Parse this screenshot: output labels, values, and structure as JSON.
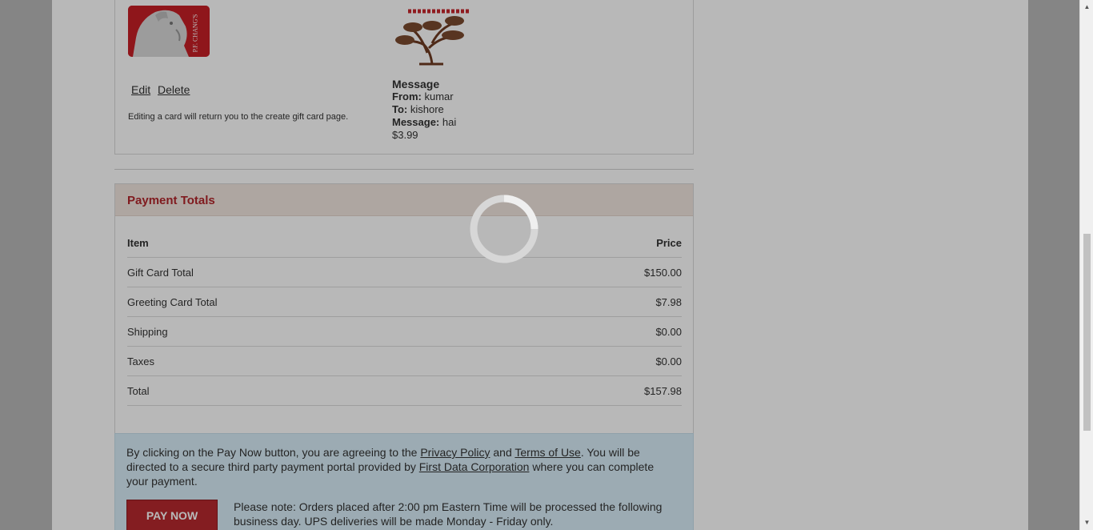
{
  "cart_item": {
    "card_image_alt": "P.F. Chang's gift card",
    "card_brand_text": "P.F. CHANG'S",
    "edit_label": "Edit",
    "delete_label": "Delete",
    "edit_note": "Editing a card will return you to the create gift card page.",
    "message_title": "Message",
    "from_label": "From:",
    "from_value": "kumar",
    "to_label": "To:",
    "to_value": "kishore",
    "message_label": "Message:",
    "message_value": "hai",
    "price": "$3.99"
  },
  "payment_totals": {
    "title": "Payment Totals",
    "header": {
      "item": "Item",
      "price": "Price"
    },
    "rows": [
      {
        "label": "Gift Card Total",
        "value": "$150.00"
      },
      {
        "label": "Greeting Card Total",
        "value": "$7.98"
      },
      {
        "label": "Shipping",
        "value": "$0.00"
      },
      {
        "label": "Taxes",
        "value": "$0.00"
      },
      {
        "label": "Total",
        "value": "$157.98"
      }
    ]
  },
  "notice": {
    "text_before": "By clicking on the Pay Now button, you are agreeing to the ",
    "privacy_link": "Privacy Policy",
    "and_text": " and ",
    "terms_link": "Terms of Use",
    "text_middle": ". You will be directed to a secure third party payment portal provided by ",
    "first_data_link": "First Data Corporation",
    "text_after": " where you can complete your payment.",
    "pay_button": "PAY NOW",
    "pay_note": "Please note: Orders placed after 2:00 pm Eastern Time will be processed the following business day. UPS deliveries will be made Monday - Friday only."
  },
  "colors": {
    "brand_red": "#b7292f",
    "notice_bg": "#d9eef8",
    "header_bg": "#f2e6e0"
  },
  "loading": {
    "spinner": "loading-spinner-icon"
  }
}
